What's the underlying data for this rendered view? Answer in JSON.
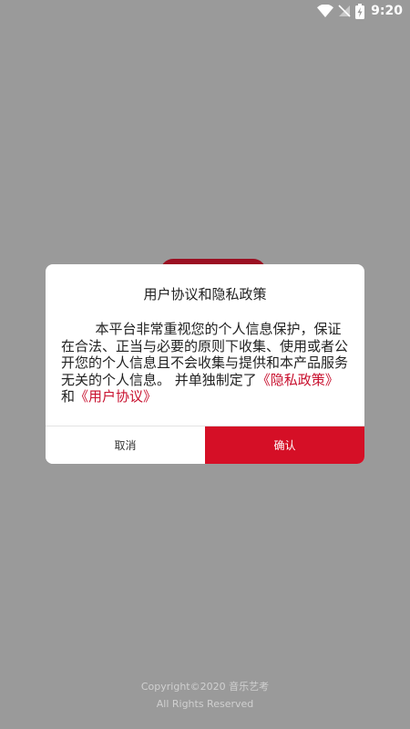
{
  "status_bar": {
    "time": "9:20",
    "icons": [
      "wifi-icon",
      "no-signal-icon",
      "battery-charging-icon"
    ]
  },
  "dialog": {
    "title": "用户协议和隐私政策",
    "body_text": "本平台非常重视您的个人信息保护，保证在合法、正当与必要的原则下收集、使用或者公开您的个人信息且不会收集与提供和本产品服务无关的个人信息。 并单独制定了",
    "privacy_link": "《隐私政策》",
    "conjunction": "和",
    "agreement_link": "《用户协议》",
    "cancel_label": "取消",
    "confirm_label": "确认"
  },
  "footer": {
    "copyright": "Copyright©2020 音乐艺考",
    "rights": "All Rights Reserved"
  },
  "colors": {
    "accent": "#d50f26",
    "link": "#c8102e",
    "overlay": "#9a9a9a"
  }
}
